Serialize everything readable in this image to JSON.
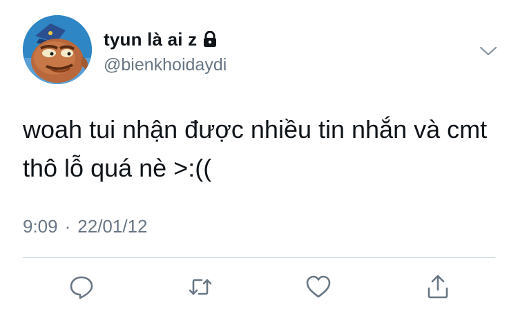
{
  "user": {
    "display_name": "tyun là ai z",
    "handle": "@bienkhoidaydi",
    "protected_icon": "lock-icon",
    "avatar": "cartoon-fish-avatar"
  },
  "tweet": {
    "text": "woah tui nhận được nhiều tin nhắn và cmt thô lỗ quá nè >:((",
    "time": "9:09",
    "separator": "·",
    "date": "22/01/12"
  },
  "actions": [
    {
      "icon": "reply-icon"
    },
    {
      "icon": "retweet-icon"
    },
    {
      "icon": "like-icon"
    },
    {
      "icon": "share-icon"
    }
  ],
  "menu_icon": "chevron-down-icon",
  "colors": {
    "text": "#0f1419",
    "secondary": "#687684",
    "divider": "#cfd9de",
    "icon": "#687684"
  }
}
